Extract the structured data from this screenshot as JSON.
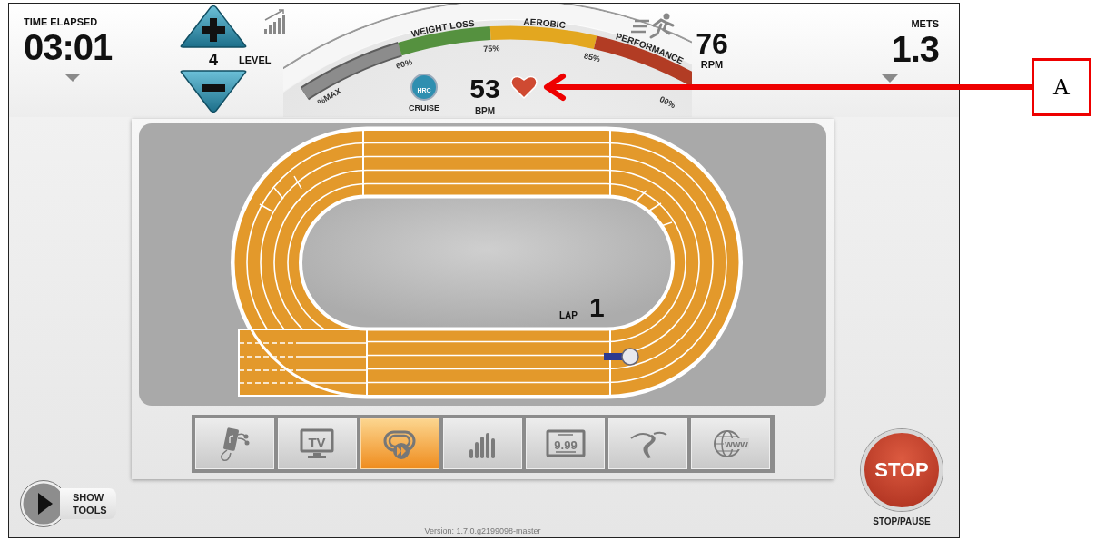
{
  "time_elapsed": {
    "label": "TIME ELAPSED",
    "value": "03:01"
  },
  "level": {
    "value": "4",
    "label": "LEVEL"
  },
  "heart_rate_gauge": {
    "zones": [
      {
        "label": "WEIGHT LOSS",
        "color": "#55913f"
      },
      {
        "label": "AEROBIC",
        "color": "#e3a71f"
      },
      {
        "label": "PERFORMANCE",
        "color": "#b23c24"
      }
    ],
    "ticks": [
      "%MAX",
      "60%",
      "75%",
      "85%",
      "00%"
    ],
    "cruise": {
      "badge": "HRC",
      "label": "CRUISE"
    },
    "bpm": "53",
    "bpm_label": "BPM"
  },
  "rpm": {
    "value": "76",
    "label": "RPM"
  },
  "mets": {
    "label": "METS",
    "value": "1.3"
  },
  "track": {
    "lap_label": "LAP",
    "lap": "1"
  },
  "apps": [
    {
      "kind": "music",
      "selected": false
    },
    {
      "kind": "tv",
      "text": "TV",
      "selected": false
    },
    {
      "kind": "laps",
      "selected": true
    },
    {
      "kind": "stats",
      "selected": false
    },
    {
      "kind": "price",
      "text": "9.99",
      "selected": false
    },
    {
      "kind": "road",
      "selected": false
    },
    {
      "kind": "web",
      "text": "www",
      "selected": false
    }
  ],
  "show_tools": "SHOW TOOLS",
  "version": "Version: 1.7.0.g2199098-master",
  "stop": {
    "label": "STOP",
    "caption": "STOP/PAUSE"
  },
  "annotation": {
    "label": "A"
  }
}
